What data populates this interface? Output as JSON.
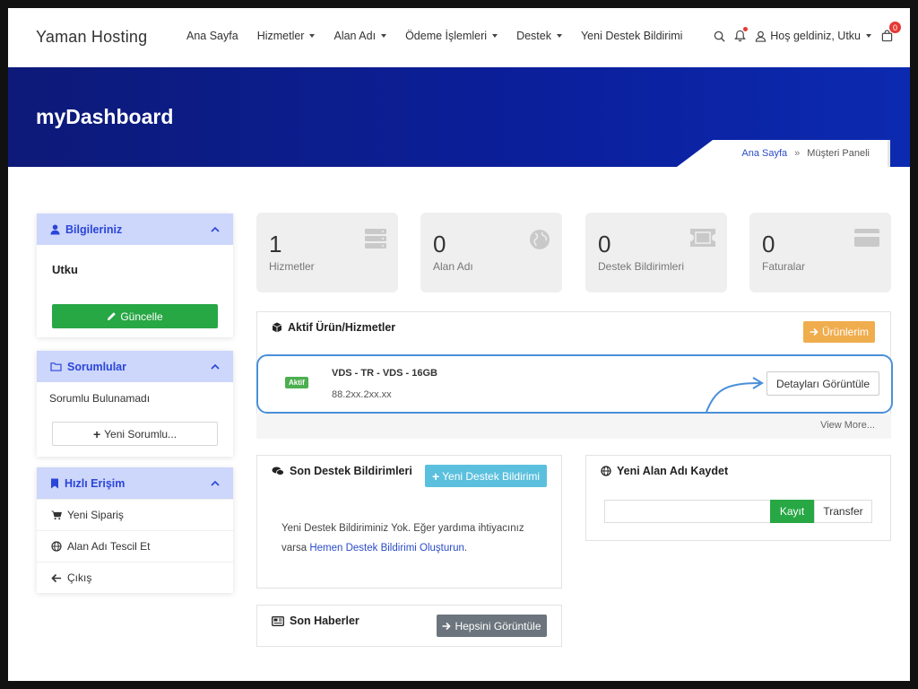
{
  "brand": "Yaman Hosting",
  "nav": {
    "items": [
      {
        "label": "Ana Sayfa",
        "dropdown": false
      },
      {
        "label": "Hizmetler",
        "dropdown": true
      },
      {
        "label": "Alan Adı",
        "dropdown": true
      },
      {
        "label": "Ödeme İşlemleri",
        "dropdown": true
      },
      {
        "label": "Destek",
        "dropdown": true
      },
      {
        "label": "Yeni Destek Bildirimi",
        "dropdown": false
      }
    ],
    "user_greeting": "Hoş geldiniz, Utku",
    "cart_count": "0",
    "icons": [
      "search-icon",
      "bell-icon",
      "user-icon",
      "cart-icon"
    ]
  },
  "hero": {
    "title": "myDashboard",
    "breadcrumb": {
      "home": "Ana Sayfa",
      "sep": "»",
      "current": "Müşteri Paneli"
    }
  },
  "sidebar": {
    "profile": {
      "title": "Bilgileriniz",
      "name": "Utku",
      "update_label": "Güncelle"
    },
    "contacts": {
      "title": "Sorumlular",
      "empty_text": "Sorumlu Bulunamadı",
      "new_label": "Yeni Sorumlu..."
    },
    "quick": {
      "title": "Hızlı Erişim",
      "items": [
        {
          "label": "Yeni Sipariş",
          "icon": "cart-icon"
        },
        {
          "label": "Alan Adı Tescil Et",
          "icon": "globe-icon"
        },
        {
          "label": "Çıkış",
          "icon": "arrow-left-icon"
        }
      ]
    }
  },
  "stats": [
    {
      "value": "1",
      "label": "Hizmetler",
      "icon": "server-icon"
    },
    {
      "value": "0",
      "label": "Alan Adı",
      "icon": "globe-icon"
    },
    {
      "value": "0",
      "label": "Destek Bildirimleri",
      "icon": "ticket-icon"
    },
    {
      "value": "0",
      "label": "Faturalar",
      "icon": "credit-card-icon"
    }
  ],
  "active_services": {
    "title": "Aktif Ürün/Hizmetler",
    "button": "Ürünlerim",
    "item": {
      "status": "Aktif",
      "name": "VDS - TR - VDS - 16GB",
      "ip": "88.2xx.2xx.xx",
      "details_label": "Detayları Görüntüle"
    },
    "view_more": "View More..."
  },
  "tickets": {
    "title": "Son Destek Bildirimleri",
    "button": "Yeni Destek Bildirimi",
    "empty_text": "Yeni Destek Bildiriminiz Yok. Eğer yardıma ihtiyacınız varsa",
    "empty_link": "Hemen Destek Bildirimi Oluşturun",
    "empty_end": "."
  },
  "domain": {
    "title": "Yeni Alan Adı Kaydet",
    "input_value": "",
    "register_label": "Kayıt",
    "transfer_label": "Transfer"
  },
  "news": {
    "title": "Son Haberler",
    "button": "Hepsini Görüntüle"
  },
  "colors": {
    "hero": "#0b1f9c",
    "sidebar_header": "#cdd6fb",
    "sidebar_header_text": "#2a45d8",
    "green": "#28a745",
    "orange": "#f0ad4e",
    "cyan": "#5bc0de",
    "gray": "#6c757d",
    "highlight_border": "#4a90d9"
  }
}
